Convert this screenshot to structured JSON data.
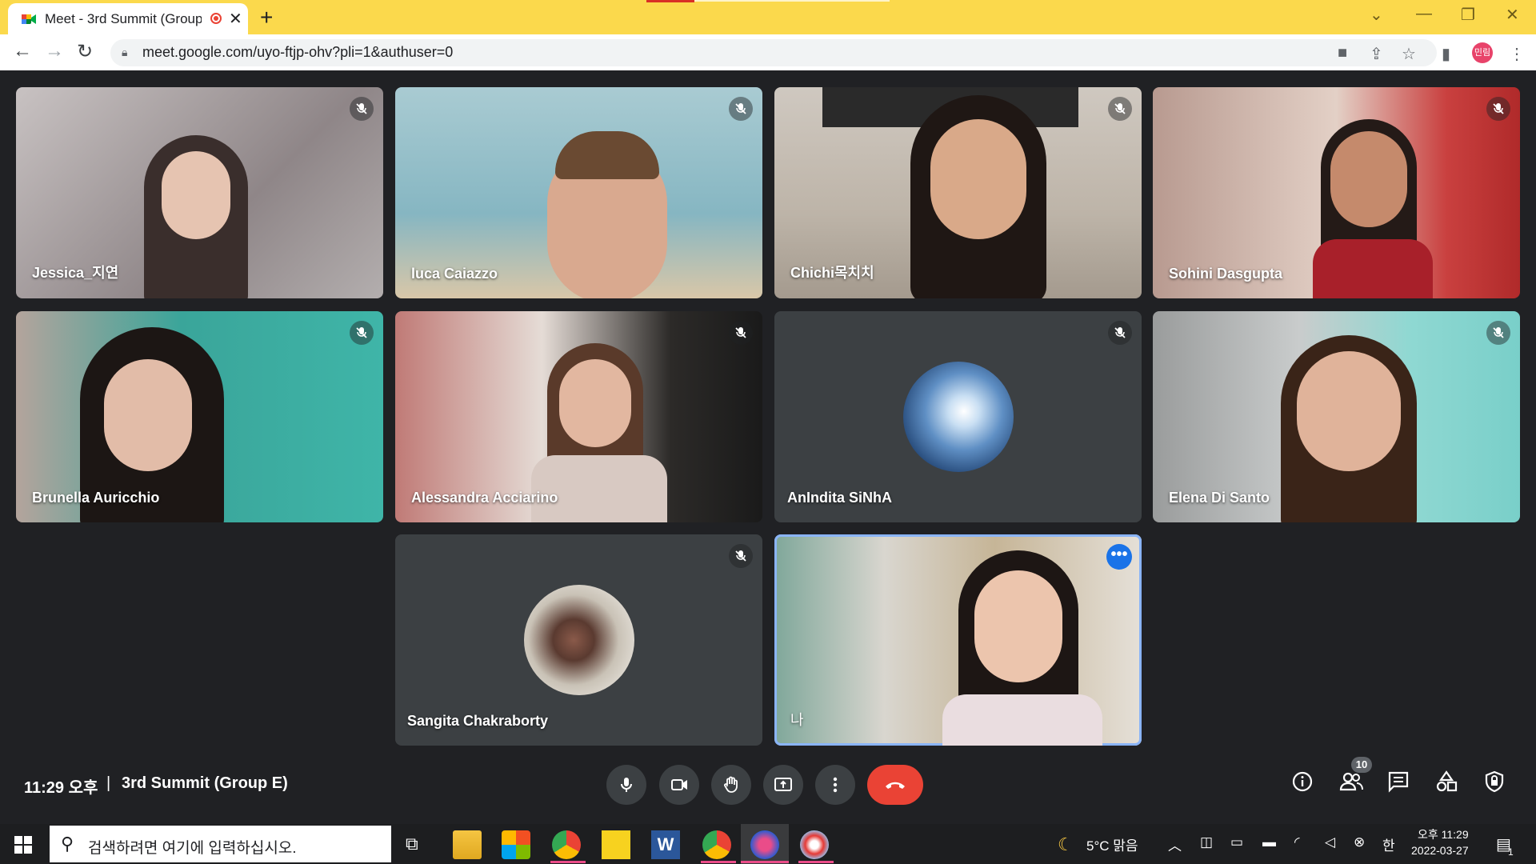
{
  "browser": {
    "tab_title": "Meet - 3rd Summit (Group",
    "tab_close": "✕",
    "new_tab": "+",
    "url": "meet.google.com/uyo-ftjp-ohv?pli=1&authuser=0",
    "profile_initials": "민림",
    "back_icon": "←",
    "forward_icon": "→",
    "reload_icon": "↻"
  },
  "participants": [
    {
      "name": "Jessica_지연",
      "muted": true
    },
    {
      "name": "luca Caiazzo",
      "muted": true
    },
    {
      "name": "Chichi목치치",
      "muted": true
    },
    {
      "name": "Sohini Dasgupta",
      "muted": true
    },
    {
      "name": "Brunella Auricchio",
      "muted": true
    },
    {
      "name": "Alessandra Acciarino",
      "muted": true
    },
    {
      "name": "AnIndita SiNhA",
      "muted": true
    },
    {
      "name": "Elena Di Santo",
      "muted": true
    },
    {
      "name": "Sangita Chakraborty",
      "muted": true
    },
    {
      "name": "나",
      "self": true
    }
  ],
  "meeting": {
    "time": "11:29 오후",
    "separator": "|",
    "title": "3rd Summit (Group E)",
    "participant_count": "10",
    "more_options": "•••"
  },
  "taskbar": {
    "search_placeholder": "검색하려면 여기에 입력하십시오.",
    "weather": "5°C 맑음",
    "ime": "한",
    "time": "오후 11:29",
    "date": "2022-03-27",
    "notifications": "1"
  },
  "colors": {
    "tab_bar": "#fbd94c",
    "end_call": "#ea4335",
    "self_outline": "#8ab4f8",
    "meet_bg": "#202124"
  }
}
